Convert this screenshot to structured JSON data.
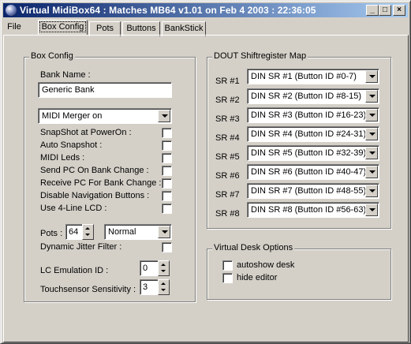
{
  "window": {
    "title": "Virtual MidiBox64 : Matches MB64 v1.01 on Feb  4 2003 : 22:36:05",
    "minimize": "_",
    "maximize": "□",
    "close": "×"
  },
  "menu": {
    "file": "File"
  },
  "tabs": [
    "Box Config",
    "Pots",
    "Buttons",
    "BankStick"
  ],
  "box_config": {
    "group_title": "Box Config",
    "bank_name_label": "Bank Name :",
    "bank_name_value": "Generic Bank",
    "merger_value": "MIDI Merger on",
    "options": [
      "SnapShot at PowerOn :",
      "Auto Snapshot :",
      "MIDI Leds :",
      "Send PC On Bank Change :",
      "Receive PC For Bank Change :",
      "Disable Navigation Buttons :",
      "Use 4-Line LCD :"
    ],
    "pots_label": "Pots :",
    "pots_value": "64",
    "pots_mode": "Normal",
    "jitter_label": "Dynamic Jitter Filter :",
    "lc_label": "LC Emulation ID :",
    "lc_value": "0",
    "touch_label": "Touchsensor Sensitivity :",
    "touch_value": "3"
  },
  "dout": {
    "group_title": "DOUT Shiftregister Map",
    "rows": [
      {
        "label": "SR #1",
        "value": "DIN SR #1 (Button ID #0-7)"
      },
      {
        "label": "SR #2",
        "value": "DIN SR #2 (Button ID #8-15)"
      },
      {
        "label": "SR #3",
        "value": "DIN SR #3 (Button ID #16-23)"
      },
      {
        "label": "SR #4",
        "value": "DIN SR #4 (Button ID #24-31)"
      },
      {
        "label": "SR #5",
        "value": "DIN SR #5 (Button ID #32-39)"
      },
      {
        "label": "SR #6",
        "value": "DIN SR #6 (Button ID #40-47)"
      },
      {
        "label": "SR #7",
        "value": "DIN SR #7 (Button ID #48-55)"
      },
      {
        "label": "SR #8",
        "value": "DIN SR #8 (Button ID #56-63)"
      }
    ]
  },
  "desk": {
    "group_title": "Virtual Desk Options",
    "autoshow": "autoshow desk",
    "hide_editor": "hide editor"
  }
}
